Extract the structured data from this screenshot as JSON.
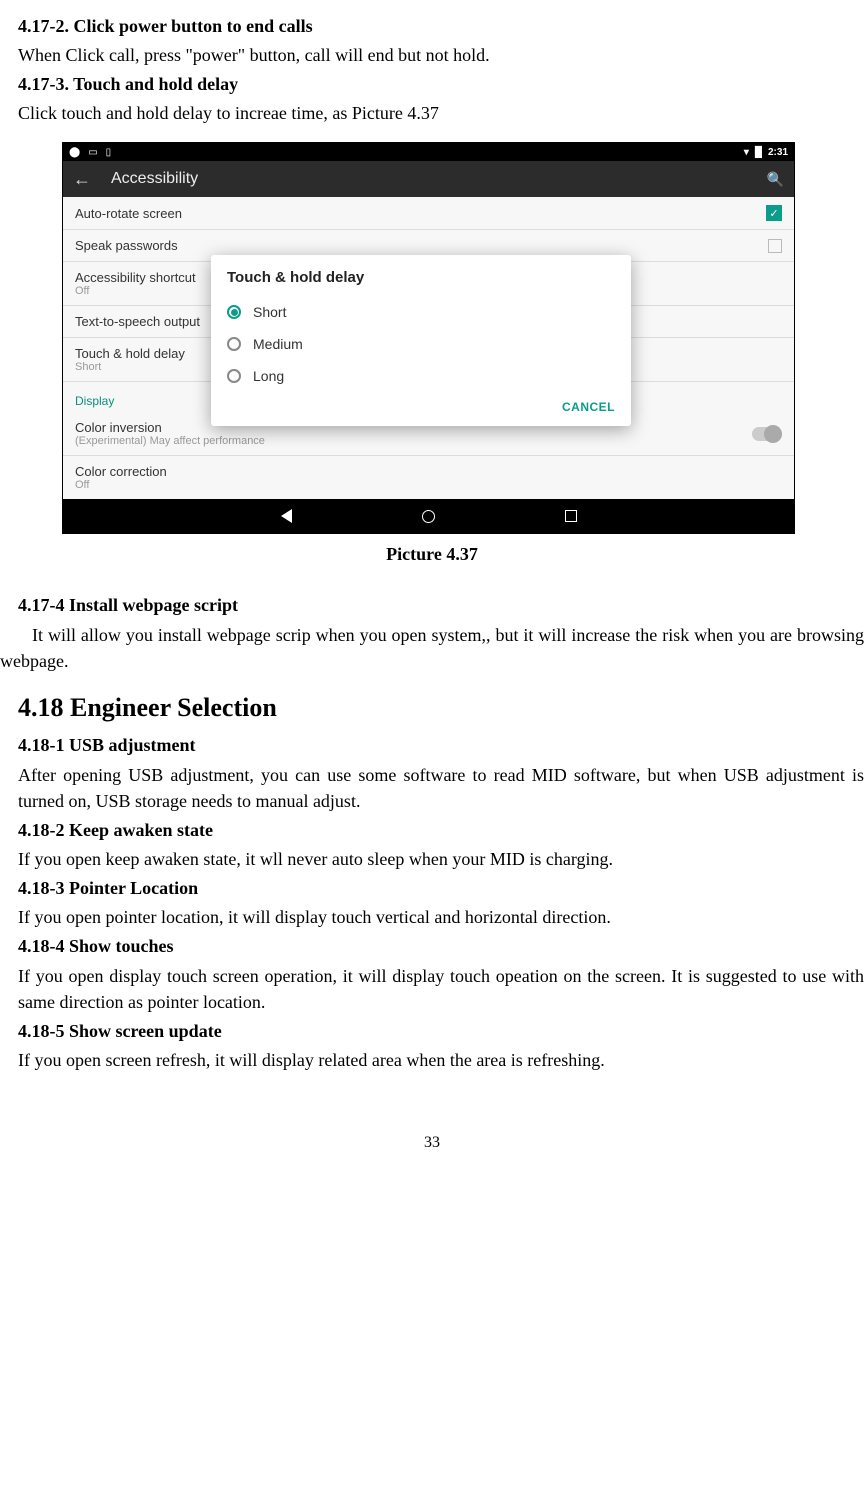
{
  "sec4172": {
    "heading": "4.17-2. Click power button to end calls",
    "body": "When Click call, press \"power\" button, call will end but not hold."
  },
  "sec4173": {
    "heading": "4.17-3. Touch and hold delay",
    "body": "Click touch and hold delay to increae time, as Picture 4.37"
  },
  "screenshot": {
    "status": {
      "time": "2:31",
      "batt": "█"
    },
    "appbar": {
      "title": "Accessibility"
    },
    "rows": {
      "autorotate": {
        "label": "Auto-rotate screen"
      },
      "speakpw": {
        "label": "Speak passwords"
      },
      "shortcut": {
        "label": "Accessibility shortcut",
        "sub": "Off"
      },
      "tts": {
        "label": "Text-to-speech output"
      },
      "touchhold": {
        "label": "Touch & hold delay",
        "sub": "Short"
      },
      "display": {
        "label": "Display"
      },
      "colorinv": {
        "label": "Color inversion",
        "sub": "(Experimental) May affect performance"
      },
      "colorcorr": {
        "label": "Color correction",
        "sub": "Off"
      }
    },
    "dialog": {
      "title": "Touch & hold delay",
      "opt1": "Short",
      "opt2": "Medium",
      "opt3": "Long",
      "cancel": "CANCEL"
    }
  },
  "caption": "Picture 4.37",
  "sec4174": {
    "heading": "4.17-4 Install webpage script",
    "body": "It will allow you install webpage scrip when you open system,, but it will increase the risk when you are browsing webpage."
  },
  "sec418": {
    "heading": "4.18 Engineer Selection"
  },
  "sec4181": {
    "heading": "4.18-1 USB adjustment",
    "body": "After opening USB adjustment, you can use some software to read MID software, but when USB adjustment is turned on, USB storage needs to manual adjust."
  },
  "sec4182": {
    "heading": "4.18-2 Keep awaken state",
    "body": "If you open keep awaken state, it wll never auto sleep when your MID is charging."
  },
  "sec4183": {
    "heading": "4.18-3 Pointer Location",
    "body": "If you open pointer location, it will display touch vertical and horizontal direction."
  },
  "sec4184": {
    "heading": "4.18-4 Show touches",
    "body": "If you open display touch screen operation, it will display touch opeation on the screen. It is suggested to use with same direction as pointer location."
  },
  "sec4185": {
    "heading": "4.18-5 Show screen update",
    "body": "If you open screen refresh, it will display related area when the area is refreshing."
  },
  "pageNumber": "33"
}
